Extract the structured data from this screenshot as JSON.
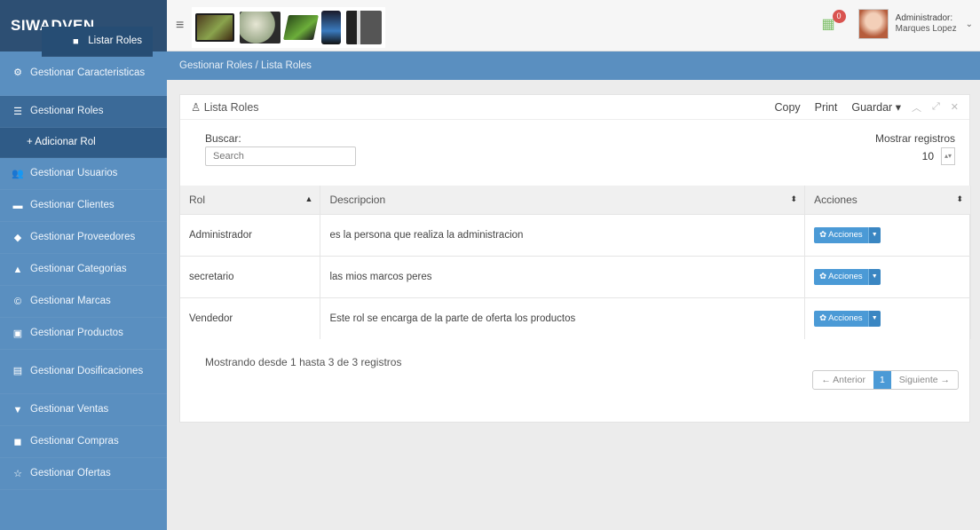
{
  "brand": "SIWADVEN",
  "sidebar": {
    "items": [
      {
        "icon": "gears-icon",
        "label": "Gestionar Caracteristicas",
        "glyph": "⚙"
      },
      {
        "icon": "table-icon",
        "label": "Gestionar Roles",
        "glyph": "☰"
      },
      {
        "icon": "plus-icon",
        "label": "+ Adicionar Rol",
        "glyph": ""
      },
      {
        "icon": "list-icon",
        "label": "Listar Roles",
        "glyph": "■"
      },
      {
        "icon": "users-icon",
        "label": "Gestionar Usuarios",
        "glyph": "👥"
      },
      {
        "icon": "briefcase-icon",
        "label": "Gestionar Clientes",
        "glyph": "▬"
      },
      {
        "icon": "group-icon",
        "label": "Gestionar Proveedores",
        "glyph": "◆"
      },
      {
        "icon": "sitemap-icon",
        "label": "Gestionar Categorias",
        "glyph": "▲"
      },
      {
        "icon": "copyright-icon",
        "label": "Gestionar Marcas",
        "glyph": "©"
      },
      {
        "icon": "image-icon",
        "label": "Gestionar Productos",
        "glyph": "▣"
      },
      {
        "icon": "document-icon",
        "label": "Gestionar Dosificaciones",
        "glyph": "▤"
      },
      {
        "icon": "cart-icon",
        "label": "Gestionar Ventas",
        "glyph": "▼"
      },
      {
        "icon": "truck-icon",
        "label": "Gestionar Compras",
        "glyph": "◼"
      },
      {
        "icon": "star-icon",
        "label": "Gestionar Ofertas",
        "glyph": "☆"
      }
    ]
  },
  "header": {
    "menu_glyph": "≡",
    "notification_count": "0",
    "user_role": "Administrador:",
    "user_name": "Marques Lopez"
  },
  "breadcrumb": "Gestionar Roles / Lista Roles",
  "panel": {
    "title": "Lista Roles",
    "title_icon": "user-icon",
    "tools": [
      "Copy",
      "Print",
      "Guardar ▾"
    ],
    "search_label": "Buscar:",
    "search_placeholder": "Search",
    "show_label": "Mostrar registros",
    "show_value": "10",
    "columns": [
      "Rol",
      "Descripcion",
      "Acciones"
    ],
    "rows": [
      {
        "rol": "Administrador",
        "descripcion": "es la persona que realiza la administracion",
        "accion": "✿ Acciones"
      },
      {
        "rol": "secretario",
        "descripcion": "las mios marcos peres",
        "accion": "✿ Acciones"
      },
      {
        "rol": "Vendedor",
        "descripcion": "Este rol se encarga de la parte de oferta los productos",
        "accion": "✿ Acciones"
      }
    ],
    "info": "Mostrando desde 1 hasta 3 de 3 registros",
    "pager": {
      "prev": "← Anterior",
      "current": "1",
      "next": "Siguiente →"
    }
  }
}
